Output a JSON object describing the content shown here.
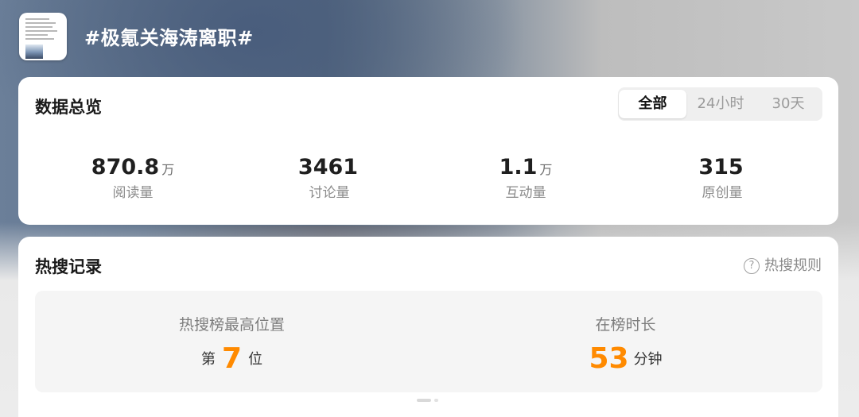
{
  "topic": {
    "title": "#极氪关海涛离职#"
  },
  "overview": {
    "title": "数据总览",
    "filters": [
      {
        "label": "全部",
        "active": true
      },
      {
        "label": "24小时",
        "active": false
      },
      {
        "label": "30天",
        "active": false
      }
    ],
    "stats": [
      {
        "value": "870.8",
        "unit": "万",
        "label": "阅读量"
      },
      {
        "value": "3461",
        "unit": "",
        "label": "讨论量"
      },
      {
        "value": "1.1",
        "unit": "万",
        "label": "互动量"
      },
      {
        "value": "315",
        "unit": "",
        "label": "原创量"
      }
    ]
  },
  "hot_search": {
    "title": "热搜记录",
    "rules_label": "热搜规则",
    "rules_icon": "question-circle-icon",
    "highest_rank": {
      "label": "热搜榜最高位置",
      "prefix": "第",
      "value": "7",
      "suffix": "位"
    },
    "duration": {
      "label": "在榜时长",
      "value": "53",
      "suffix": "分钟"
    },
    "accent_color": "#ff8a00",
    "pager": {
      "pages": 2,
      "current": 1
    }
  }
}
